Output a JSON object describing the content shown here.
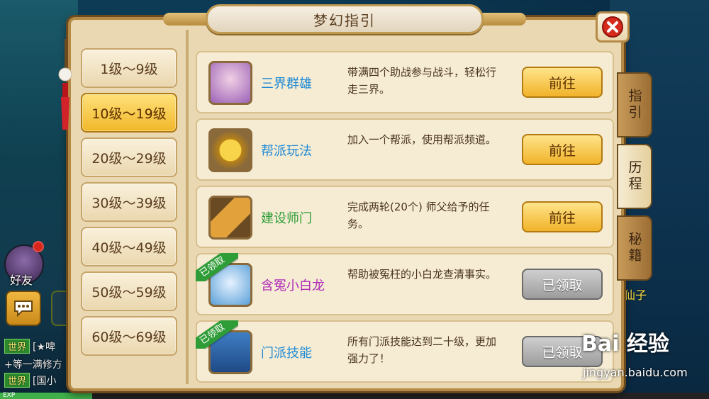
{
  "title": "梦幻指引",
  "levels": [
    "1级～9级",
    "10级～19级",
    "20级～29级",
    "30级～39级",
    "40级～49级",
    "50级～59级",
    "60级～69级"
  ],
  "active_level_index": 1,
  "tasks": [
    {
      "name": "三界群雄",
      "name_color": "#1f8ad6",
      "desc": "带满四个助战参与战斗，轻松行走三界。",
      "button": "前往",
      "button_state": "go",
      "claimed": false
    },
    {
      "name": "帮派玩法",
      "name_color": "#1f8ad6",
      "desc": "加入一个帮派，使用帮派频道。",
      "button": "前往",
      "button_state": "go",
      "claimed": false
    },
    {
      "name": "建设师门",
      "name_color": "#2e9c37",
      "desc": "完成两轮(20个) 师父给予的任务。",
      "button": "前往",
      "button_state": "go",
      "claimed": false
    },
    {
      "name": "含冤小白龙",
      "name_color": "#b02ab8",
      "desc": "帮助被冤枉的小白龙查清事实。",
      "button": "已领取",
      "button_state": "done",
      "claimed": true,
      "claimed_label": "已领取"
    },
    {
      "name": "门派技能",
      "name_color": "#1f8ad6",
      "desc": "所有门派技能达到二十级，更加强力了！",
      "button": "已领取",
      "button_state": "done",
      "claimed": true,
      "claimed_label": "已领取"
    }
  ],
  "side_tabs": [
    {
      "label": "指引",
      "active": false
    },
    {
      "label": "历程",
      "active": true
    },
    {
      "label": "秘籍",
      "active": false
    }
  ],
  "hud": {
    "friend_label": "好友",
    "chat_lines": [
      {
        "tag": "世界",
        "text": "[★啤"
      },
      {
        "tag": "",
        "text": "+等一满修方"
      },
      {
        "tag": "世界",
        "text": "[国小"
      }
    ],
    "exp_label": "EXP",
    "exp_progress": 0.13,
    "npc_label": "仙子"
  },
  "watermark": {
    "logo": "Bai 经验",
    "url": "jingyan.baidu.com"
  }
}
